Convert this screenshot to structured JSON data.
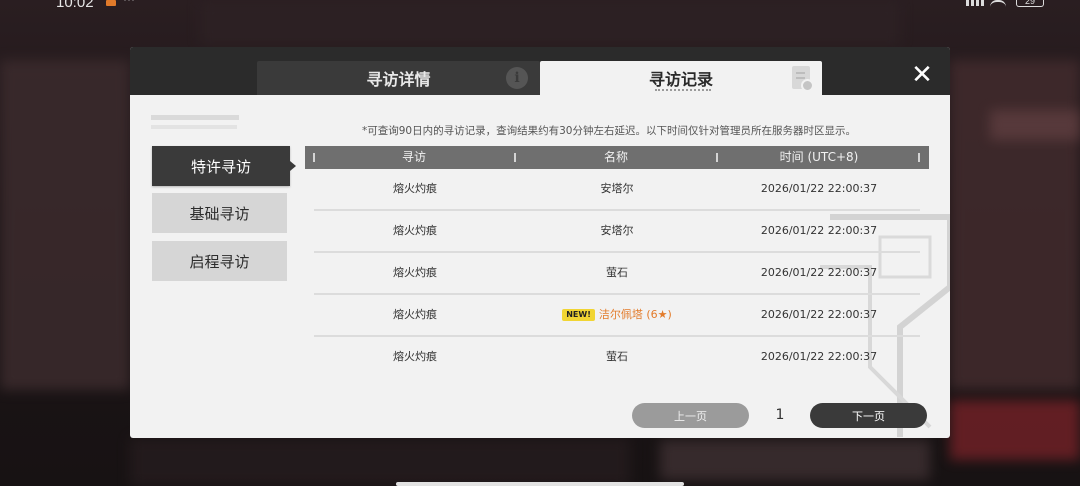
{
  "status_bar": {
    "time": "10:02",
    "more": "···",
    "battery": "29"
  },
  "dialog": {
    "tabs": [
      {
        "label": "寻访详情",
        "active": false,
        "icon": "info-icon"
      },
      {
        "label": "寻访记录",
        "active": true,
        "icon": "document-icon"
      }
    ],
    "close_icon": "close-icon"
  },
  "side_menu": [
    {
      "label": "特许寻访",
      "active": true
    },
    {
      "label": "基础寻访",
      "active": false
    },
    {
      "label": "启程寻访",
      "active": false
    }
  ],
  "notice": "*可查询90日内的寻访记录，查询结果约有30分钟左右延迟。以下时间仅针对管理员所在服务器时区显示。",
  "table": {
    "headers": [
      "寻访",
      "名称",
      "时间 (UTC+8)"
    ],
    "rows": [
      {
        "pool": "熔火灼痕",
        "name": "安塔尔",
        "time": "2026/01/22 22:00:37",
        "is_new": false
      },
      {
        "pool": "熔火灼痕",
        "name": "安塔尔",
        "time": "2026/01/22 22:00:37",
        "is_new": false
      },
      {
        "pool": "熔火灼痕",
        "name": "萤石",
        "time": "2026/01/22 22:00:37",
        "is_new": false
      },
      {
        "pool": "熔火灼痕",
        "name": "洁尔佩塔 (6★)",
        "time": "2026/01/22 22:00:37",
        "is_new": true,
        "badge": "NEW!"
      },
      {
        "pool": "熔火灼痕",
        "name": "萤石",
        "time": "2026/01/22 22:00:37",
        "is_new": false
      }
    ]
  },
  "pagination": {
    "prev_label": "上一页",
    "page": "1",
    "next_label": "下一页"
  },
  "colors": {
    "highlight": "#e37b2a",
    "new_badge": "#f1d533",
    "dark": "#3a3a3a"
  }
}
